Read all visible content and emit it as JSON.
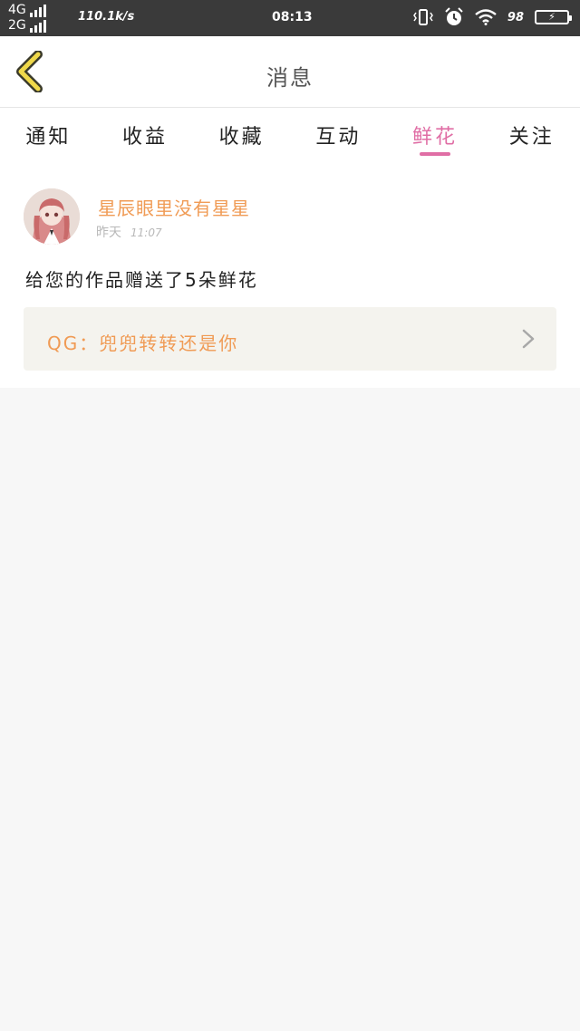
{
  "status_bar": {
    "network_top": "4G",
    "network_bottom": "2G",
    "speed": "110.1k/s",
    "time": "08:13",
    "battery_percent": "98",
    "icons": [
      "vibrate-icon",
      "alarm-icon",
      "wifi-icon",
      "battery-icon"
    ]
  },
  "header": {
    "title": "消息",
    "back_icon": "chevron-left-icon",
    "accent_color": "#f0d94a"
  },
  "tabs": [
    {
      "label": "通知",
      "active": false
    },
    {
      "label": "收益",
      "active": false
    },
    {
      "label": "收藏",
      "active": false
    },
    {
      "label": "互动",
      "active": false
    },
    {
      "label": "鲜花",
      "active": true
    },
    {
      "label": "关注",
      "active": false
    }
  ],
  "active_tab_color": "#e06ea5",
  "notification": {
    "username": "星辰眼里没有星星",
    "day": "昨天",
    "time": "11:07",
    "message": "给您的作品赠送了5朵鲜花",
    "reply": "QG：兜兜转转还是你",
    "name_color": "#f09b55"
  }
}
